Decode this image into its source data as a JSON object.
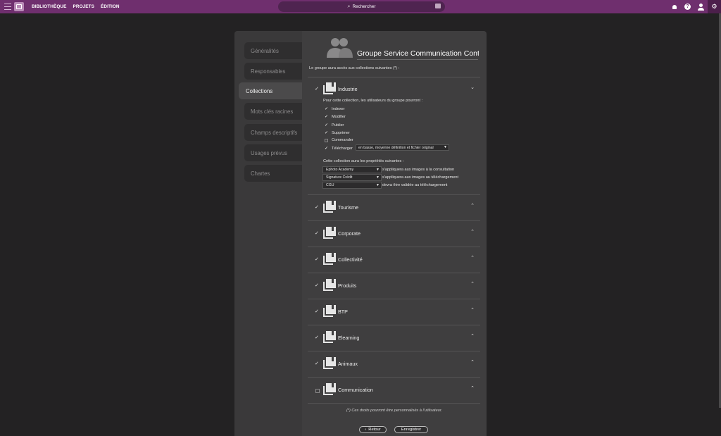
{
  "topbar": {
    "nav": [
      "BIBLIOTHÈQUE",
      "PROJETS",
      "ÉDITION"
    ],
    "search_placeholder": "Rechercher",
    "icons": [
      "bell-icon",
      "help-icon",
      "user-icon",
      "gear-icon"
    ]
  },
  "sidebar": {
    "items": [
      {
        "label": "Généralités",
        "active": false
      },
      {
        "label": "Responsables",
        "active": false
      },
      {
        "label": "Collections",
        "active": true
      },
      {
        "label": "Mots clés racines",
        "active": false
      },
      {
        "label": "Champs descriptifs",
        "active": false
      },
      {
        "label": "Usages prévus",
        "active": false
      },
      {
        "label": "Chartes",
        "active": false
      }
    ]
  },
  "group": {
    "title": "Groupe Service Communication Contrib",
    "access_text": "Le groupe aura accès aux collections suivantes (*) :"
  },
  "expanded": {
    "permissions_intro": "Pour cette collection, les utilisateurs du groupe pourront :",
    "permissions": [
      {
        "label": "Indexer",
        "checked": true
      },
      {
        "label": "Modifier",
        "checked": true
      },
      {
        "label": "Publier",
        "checked": true
      },
      {
        "label": "Supprimer",
        "checked": true
      },
      {
        "label": "Commander",
        "checked": false
      },
      {
        "label": "Télécharger",
        "checked": true
      }
    ],
    "download_option": "en basse, moyenne définition et fichier original",
    "properties_intro": "Cette collection aura les propriétés suivantes :",
    "properties": [
      {
        "value": "Ephoto Academy",
        "text": "s'appliquera aux images à la consultation"
      },
      {
        "value": "Signature Crédit",
        "text": "s'appliquera aux images au téléchargement"
      },
      {
        "value": "CGU",
        "text": "devra être validée au téléchargement"
      }
    ]
  },
  "collections": [
    {
      "name": "Industrie",
      "checked": true,
      "expanded": true
    },
    {
      "name": "Tourisme",
      "checked": true,
      "expanded": false
    },
    {
      "name": "Corporate",
      "checked": true,
      "expanded": false
    },
    {
      "name": "Collectivité",
      "checked": true,
      "expanded": false
    },
    {
      "name": "Produits",
      "checked": true,
      "expanded": false
    },
    {
      "name": "BTP",
      "checked": true,
      "expanded": false
    },
    {
      "name": "Elearning",
      "checked": true,
      "expanded": false
    },
    {
      "name": "Animaux",
      "checked": true,
      "expanded": false
    },
    {
      "name": "Communication",
      "checked": false,
      "expanded": false
    }
  ],
  "footnote": "(*) Ces droits pourront être personnalisés à l'utilisateur.",
  "buttons": {
    "back": "Retour",
    "save": "Enregistrer"
  },
  "colors": {
    "topbar": "#6f2f6e",
    "background": "#232223",
    "panel": "#3f3e3f"
  }
}
